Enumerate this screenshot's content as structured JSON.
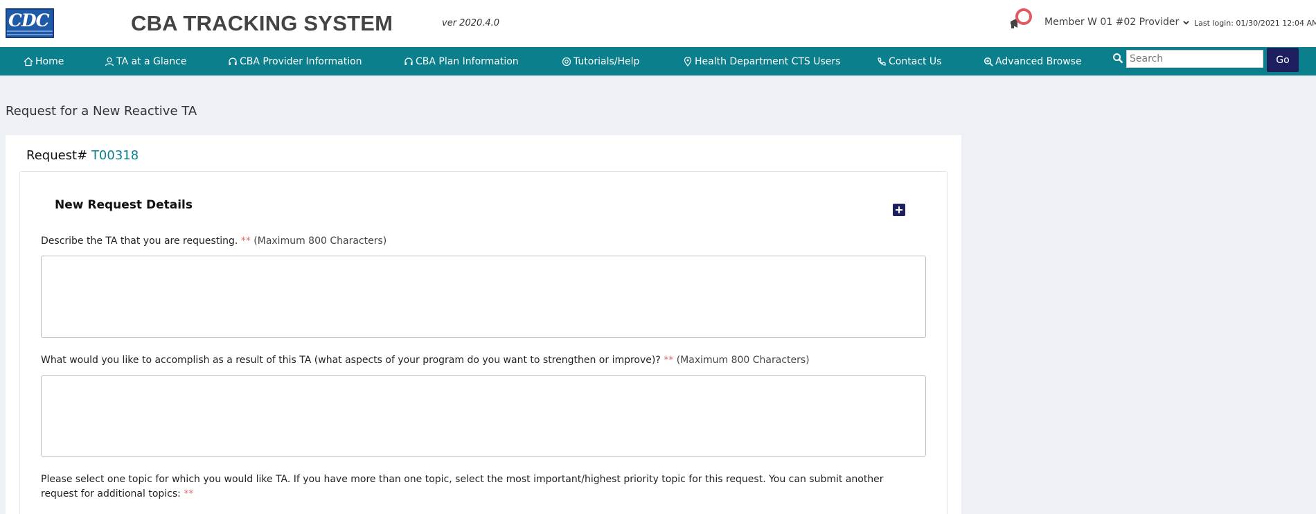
{
  "header": {
    "logo_text": "CDC",
    "app_title": "CBA TRACKING SYSTEM",
    "version": "ver 2020.4.0",
    "user_menu": "Member W 01 #02 Provider",
    "last_login": "Last login: 01/30/2021 12:04 AM"
  },
  "nav": {
    "items": [
      {
        "label": "Home",
        "icon": "home-icon"
      },
      {
        "label": "TA at a Glance",
        "icon": "user-icon"
      },
      {
        "label": "CBA Provider Information",
        "icon": "headset-icon"
      },
      {
        "label": "CBA Plan Information",
        "icon": "headset-icon"
      },
      {
        "label": "Tutorials/Help",
        "icon": "lifebuoy-icon"
      },
      {
        "label": "Health Department CTS Users",
        "icon": "map-pin-icon"
      },
      {
        "label": "Contact Us",
        "icon": "phone-icon"
      },
      {
        "label": "Advanced Browse",
        "icon": "zoom-icon"
      }
    ],
    "search_placeholder": "Search",
    "go_label": "Go"
  },
  "page": {
    "title": "Request for a New Reactive TA",
    "request_label": "Request#",
    "request_id": "T00318",
    "section_title": "New Request Details",
    "q1_label": "Describe the TA that you are requesting.",
    "q1_required": "**",
    "q1_limit": "(Maximum 800 Characters)",
    "q2_label": "What would you like to accomplish as a result of this TA (what aspects of your program do you want to strengthen or improve)?",
    "q2_required": "**",
    "q2_limit": "(Maximum 800 Characters)",
    "q3_label": "Please select one topic for which you would like TA. If you have more than one topic, select the most important/highest priority topic for this request. You can submit another request for additional topics:",
    "q3_required": "**"
  },
  "colors": {
    "nav_bg": "#0b7f8c",
    "accent_dark": "#1d1f5e",
    "required": "#e26b6b"
  }
}
